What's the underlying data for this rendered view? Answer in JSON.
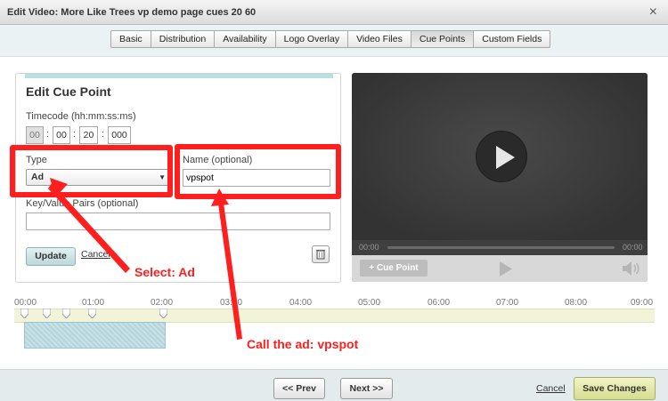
{
  "window": {
    "title": "Edit Video: More Like Trees vp demo page cues 20 60",
    "close_glyph": "×"
  },
  "tabs": [
    {
      "label": "Basic"
    },
    {
      "label": "Distribution"
    },
    {
      "label": "Availability"
    },
    {
      "label": "Logo Overlay"
    },
    {
      "label": "Video Files"
    },
    {
      "label": "Cue Points",
      "active": true
    },
    {
      "label": "Custom Fields"
    }
  ],
  "cue_form": {
    "heading": "Edit Cue Point",
    "timecode_label": "Timecode (hh:mm:ss:ms)",
    "timecode": {
      "hh": "00",
      "mm": "00",
      "ss": "20",
      "ms": "000"
    },
    "type_label": "Type",
    "type_value": "Ad",
    "name_label": "Name (optional)",
    "name_value": "vpspot",
    "keyvalue_label": "Key/Value Pairs (optional)",
    "keyvalue_value": "",
    "update_label": "Update",
    "cancel_label": "Cancel"
  },
  "player": {
    "time_start": "00:00",
    "time_end": "00:00",
    "cue_point_button": "+ Cue Point",
    "progress": 0
  },
  "timeline": {
    "labels": [
      "00:00",
      "01:00",
      "02:00",
      "03:00",
      "04:00",
      "05:00",
      "06:00",
      "07:00",
      "08:00",
      "09:00"
    ]
  },
  "footer": {
    "prev_label": "<< Prev",
    "next_label": "Next >>",
    "cancel_label": "Cancel",
    "save_label": "Save Changes"
  },
  "annotations": {
    "select_ad": "Select: Ad",
    "call_ad": "Call the ad: vpspot"
  },
  "colors": {
    "highlight": "#ff1f1f",
    "accent": "#b7e0e3",
    "save": "#d6dd8d"
  },
  "icons": [
    "close-icon",
    "dropdown-arrow-icon",
    "trash-icon",
    "play-icon",
    "volume-icon"
  ]
}
